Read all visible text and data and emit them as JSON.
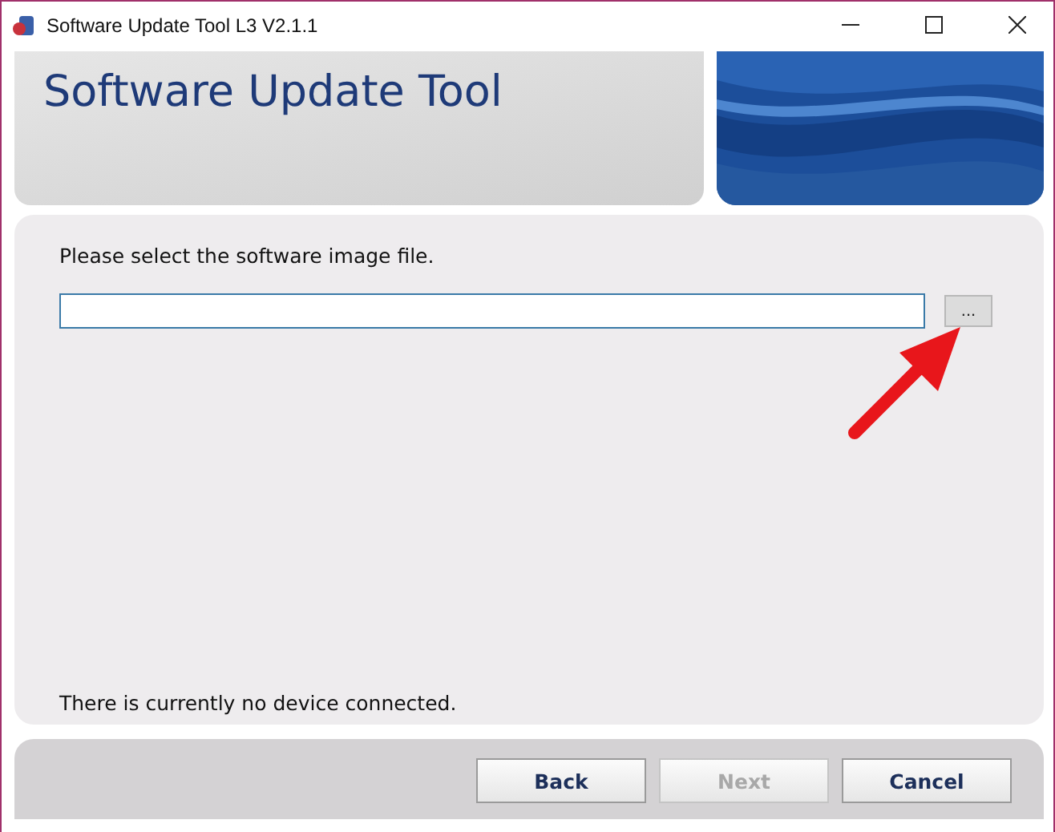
{
  "window": {
    "title": "Software Update Tool L3 V2.1.1"
  },
  "header": {
    "title": "Software Update Tool"
  },
  "main": {
    "prompt": "Please select the software image file.",
    "browse_button": "...",
    "status": "There is currently no device connected."
  },
  "buttons": [
    {
      "label": "Back",
      "disabled": false
    },
    {
      "label": "Next",
      "disabled": true
    },
    {
      "label": "Cancel",
      "disabled": false
    }
  ]
}
